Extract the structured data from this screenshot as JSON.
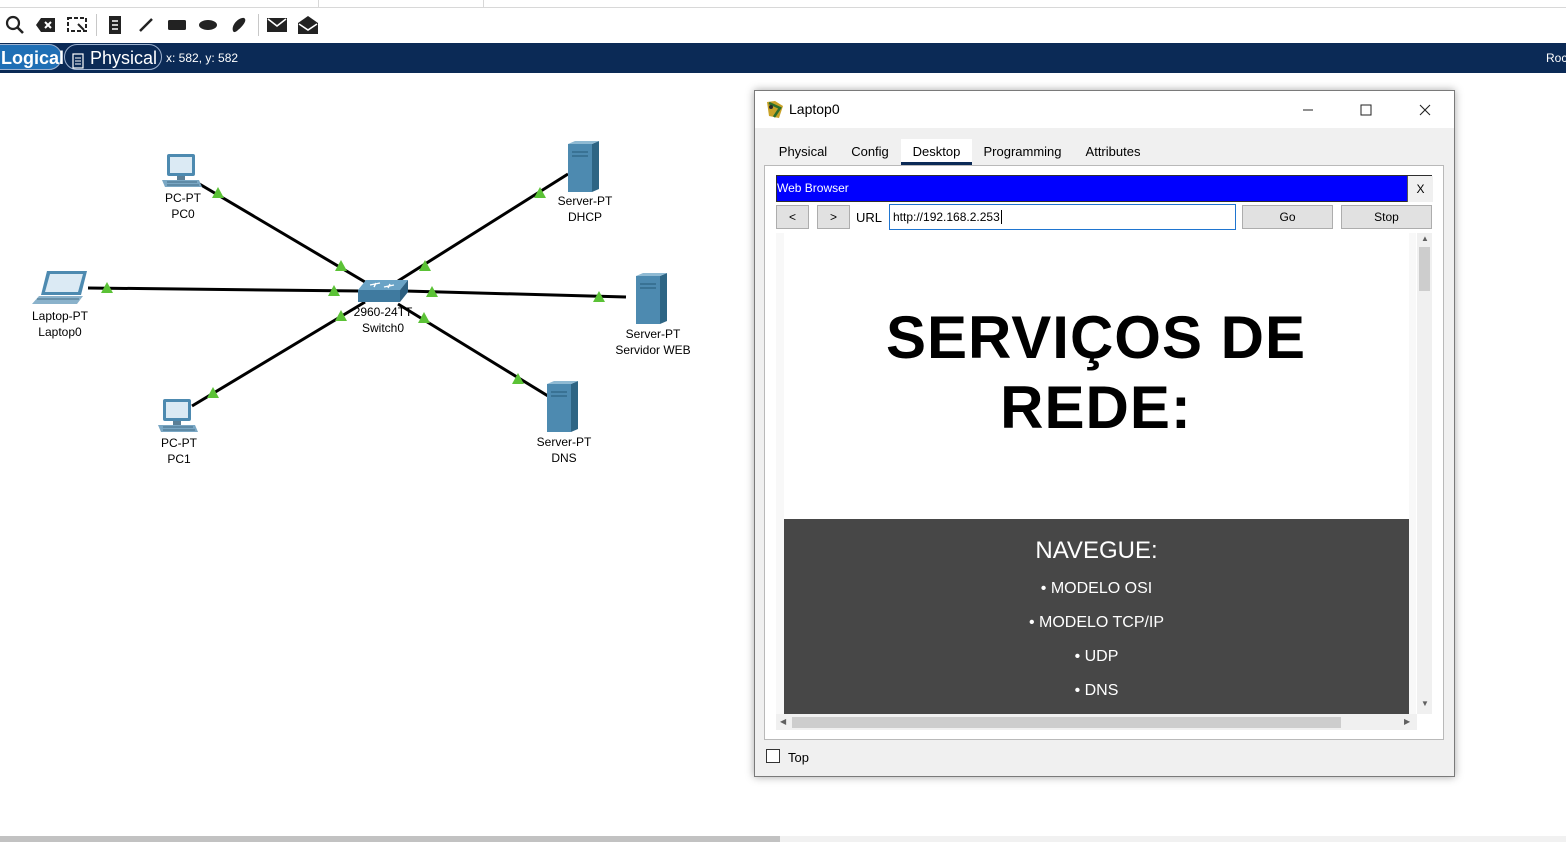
{
  "mode_bar": {
    "logical": "Logical",
    "physical": "Physical",
    "coords": "x: 582, y: 582",
    "right_text": "Roc"
  },
  "toolbar": {
    "tools": [
      "search-icon",
      "delete-icon",
      "resize-icon",
      "note-icon",
      "line-icon",
      "rectangle-icon",
      "ellipse-icon",
      "freeform-icon",
      "simple-pdu-icon",
      "complex-pdu-icon"
    ]
  },
  "topology": {
    "link_color": "#000000",
    "port_up_color": "#5bc236",
    "devices": {
      "pc0": {
        "model": "PC-PT",
        "name": "PC0"
      },
      "pc1": {
        "model": "PC-PT",
        "name": "PC1"
      },
      "laptop0": {
        "model": "Laptop-PT",
        "name": "Laptop0"
      },
      "switch0": {
        "model": "2960-24TT",
        "name": "Switch0"
      },
      "dhcp": {
        "model": "Server-PT",
        "name": "DHCP"
      },
      "web": {
        "model": "Server-PT",
        "name": "Servidor WEB"
      },
      "dns": {
        "model": "Server-PT",
        "name": "DNS"
      }
    }
  },
  "dialog": {
    "title": "Laptop0",
    "tabs": [
      "Physical",
      "Config",
      "Desktop",
      "Programming",
      "Attributes"
    ],
    "active_tab": "Desktop",
    "top_checkbox_label": "Top"
  },
  "browser": {
    "title": "Web Browser",
    "close": "X",
    "back": "<",
    "forward": ">",
    "url_label": "URL",
    "url": "http://192.168.2.253",
    "go": "Go",
    "stop": "Stop",
    "titlebar_color": "#0000ff"
  },
  "webpage": {
    "heading_line1": "SERVIÇOS DE",
    "heading_line2": "REDE:",
    "nav_title": "NAVEGUE:",
    "nav_items": [
      "• MODELO OSI",
      "• MODELO TCP/IP",
      "• UDP",
      "• DNS"
    ],
    "nav_bg": "#474747"
  }
}
